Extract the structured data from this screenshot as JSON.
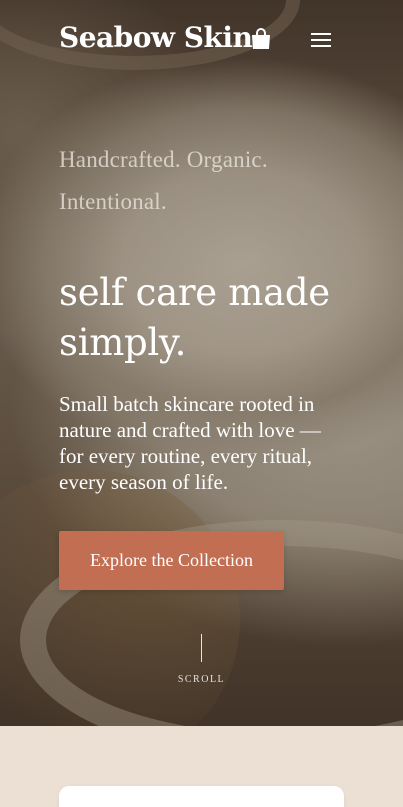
{
  "header": {
    "brand": "Seabow Skin",
    "cart_icon": "shopping-bag-icon",
    "menu_icon": "hamburger-menu-icon"
  },
  "hero": {
    "tagline": "Handcrafted. Organic. Intentional.",
    "headline": "self care made simply.",
    "subcopy": "Small batch skincare rooted in nature and crafted with love — for every routine, every ritual, every season of life.",
    "cta_label": "Explore the Collection",
    "scroll_label": "SCROLL"
  },
  "colors": {
    "accent": "#c26e52",
    "section_background": "#ece0d5",
    "card_background": "#ffffff"
  }
}
